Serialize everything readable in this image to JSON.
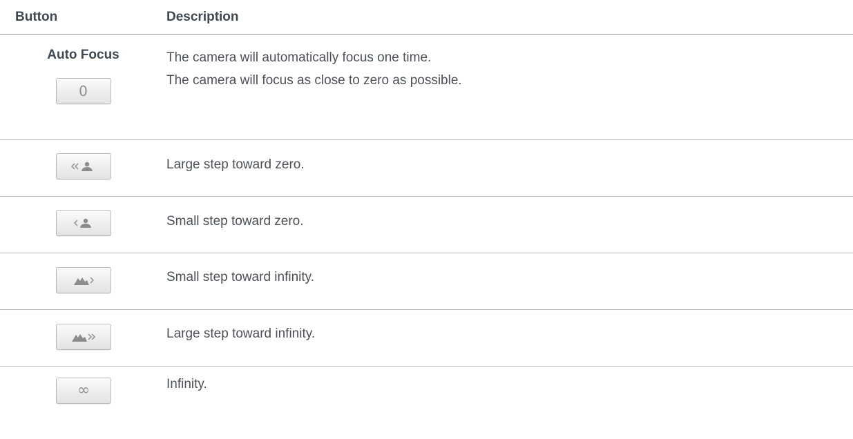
{
  "table": {
    "headers": {
      "button": "Button",
      "description": "Description"
    },
    "rows": [
      {
        "button_label": "Auto Focus",
        "icon": "auto-focus-text",
        "description": "The camera will automatically focus one time."
      },
      {
        "button_label": "0",
        "icon": "zero-icon",
        "description": "The camera will focus as close to zero as possible."
      },
      {
        "icon": "large-step-toward-zero-icon",
        "description": "Large step toward zero."
      },
      {
        "icon": "small-step-toward-zero-icon",
        "description": "Small step toward zero."
      },
      {
        "icon": "small-step-toward-infinity-icon",
        "description": "Small step toward infinity."
      },
      {
        "icon": "large-step-toward-infinity-icon",
        "description": "Large step toward infinity."
      },
      {
        "button_label": "∞",
        "icon": "infinity-icon",
        "description": "Infinity."
      }
    ]
  },
  "colors": {
    "text": "#4a5157",
    "header_rule": "#8a8f94",
    "row_rule": "#b5b8bb",
    "button_face": "#ededed",
    "icon_gray": "#8f8f8f"
  }
}
